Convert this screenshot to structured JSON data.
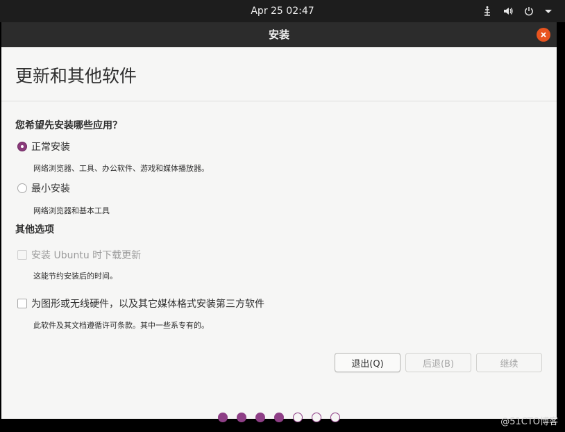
{
  "topbar": {
    "clock": "Apr 25  02:47",
    "icons": [
      "network-icon",
      "volume-icon",
      "power-icon",
      "dropdown-arrow-icon"
    ]
  },
  "window": {
    "title": "安装",
    "close_icon": "close-icon"
  },
  "page": {
    "title": "更新和其他软件"
  },
  "install_type": {
    "question": "您希望先安装哪些应用？",
    "options": [
      {
        "label": "正常安装",
        "description": "网络浏览器、工具、办公软件、游戏和媒体播放器。",
        "selected": true
      },
      {
        "label": "最小安装",
        "description": "网络浏览器和基本工具",
        "selected": false
      }
    ]
  },
  "other_options": {
    "title": "其他选项",
    "items": [
      {
        "label": "安装 Ubuntu 时下载更新",
        "description": "这能节约安装后的时间。",
        "checked": false,
        "enabled": false
      },
      {
        "label": "为图形或无线硬件，以及其它媒体格式安装第三方软件",
        "description": "此软件及其文档遵循许可条款。其中一些系专有的。",
        "checked": false,
        "enabled": true
      }
    ]
  },
  "buttons": {
    "quit": "退出(Q)",
    "back": "后退(B)",
    "continue": "继续"
  },
  "progress": {
    "current_step": 4,
    "total_steps": 7
  },
  "watermark": "@51CTO博客",
  "colors": {
    "accent": "#8e3f86",
    "close": "#e9541f",
    "titlebar": "#2c2c2c"
  }
}
